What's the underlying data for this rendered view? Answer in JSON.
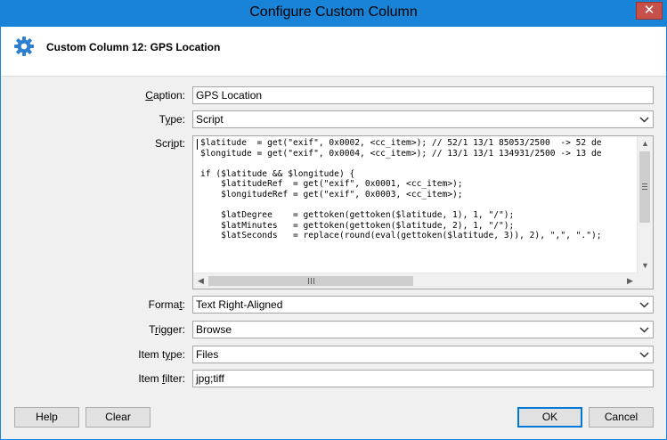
{
  "window": {
    "title": "Configure Custom Column",
    "close_label": "✕"
  },
  "header": {
    "title": "Custom Column 12: GPS Location",
    "icon": "gear-icon"
  },
  "form": {
    "caption": {
      "label_pre": "",
      "label_key": "C",
      "label_post": "aption:",
      "value": "GPS Location"
    },
    "type": {
      "label_pre": "T",
      "label_key": "y",
      "label_post": "pe:",
      "value": "Script"
    },
    "script": {
      "label_pre": "Scr",
      "label_key": "i",
      "label_post": "pt:",
      "lines": [
        "$latitude  = get(\"exif\", 0x0002, <cc_item>); // 52/1 13/1 85053/2500  -> 52 de",
        "$longitude = get(\"exif\", 0x0004, <cc_item>); // 13/1 13/1 134931/2500 -> 13 de",
        "",
        "if ($latitude && $longitude) {",
        "    $latitudeRef  = get(\"exif\", 0x0001, <cc_item>);",
        "    $longitudeRef = get(\"exif\", 0x0003, <cc_item>);",
        "",
        "    $latDegree    = gettoken(gettoken($latitude, 1), 1, \"/\");",
        "    $latMinutes   = gettoken(gettoken($latitude, 2), 1, \"/\");",
        "    $latSeconds   = replace(round(eval(gettoken($latitude, 3)), 2), \",\", \".\");"
      ],
      "scroll_up": "▲",
      "scroll_down": "▼",
      "scroll_left": "◀",
      "scroll_right": "▶"
    },
    "format": {
      "label_pre": "Forma",
      "label_key": "t",
      "label_post": ":",
      "value": "Text Right-Aligned"
    },
    "trigger": {
      "label_pre": "T",
      "label_key": "r",
      "label_post": "igger:",
      "value": "Browse"
    },
    "item_type": {
      "label_pre": "Item t",
      "label_key": "y",
      "label_post": "pe:",
      "value": "Files"
    },
    "item_filter": {
      "label_pre": "Item ",
      "label_key": "f",
      "label_post": "ilter:",
      "value": "jpg;tiff"
    }
  },
  "buttons": {
    "help": "Help",
    "clear": "Clear",
    "ok": "OK",
    "cancel": "Cancel"
  },
  "colors": {
    "titlebar": "#1883d7",
    "close": "#c7504b",
    "gear": "#2f7fd0",
    "dialog_bg": "#f0f0f0"
  }
}
